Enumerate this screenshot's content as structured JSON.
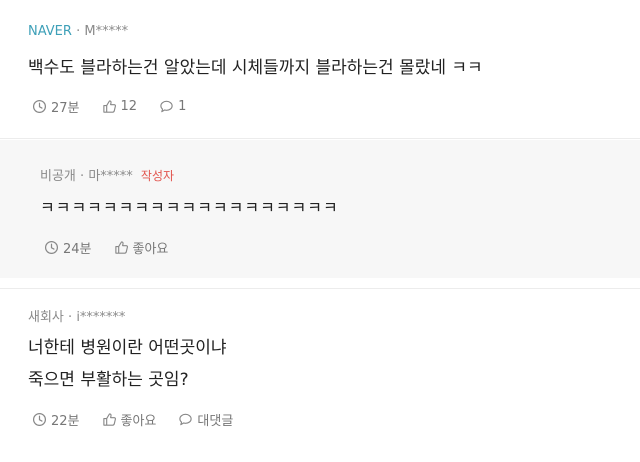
{
  "comments": [
    {
      "source": "NAVER",
      "author": "M*****",
      "text_lines": [
        "백수도 블라하는건 알았는데 시체들까지 블라하는건 몰랐네 ㅋㅋ"
      ],
      "time": "27분",
      "likes": "12",
      "replies": "1"
    },
    {
      "company": "비공개",
      "author": "마*****",
      "author_badge": "작성자",
      "text_lines": [
        "ㅋㅋㅋㅋㅋㅋㅋㅋㅋㅋㅋㅋㅋㅋㅋㅋㅋㅋㅋ"
      ],
      "time": "24분",
      "like_label": "좋아요"
    },
    {
      "company": "새회사",
      "author": "i*******",
      "text_lines": [
        "너한테 병원이란 어떤곳이냐",
        "죽으면 부활하는 곳임?"
      ],
      "time": "22분",
      "like_label": "좋아요",
      "reply_label": "대댓글"
    }
  ],
  "separator": "·",
  "icons": [
    "clock-icon",
    "thumbs-up-icon",
    "speech-bubble-icon"
  ]
}
